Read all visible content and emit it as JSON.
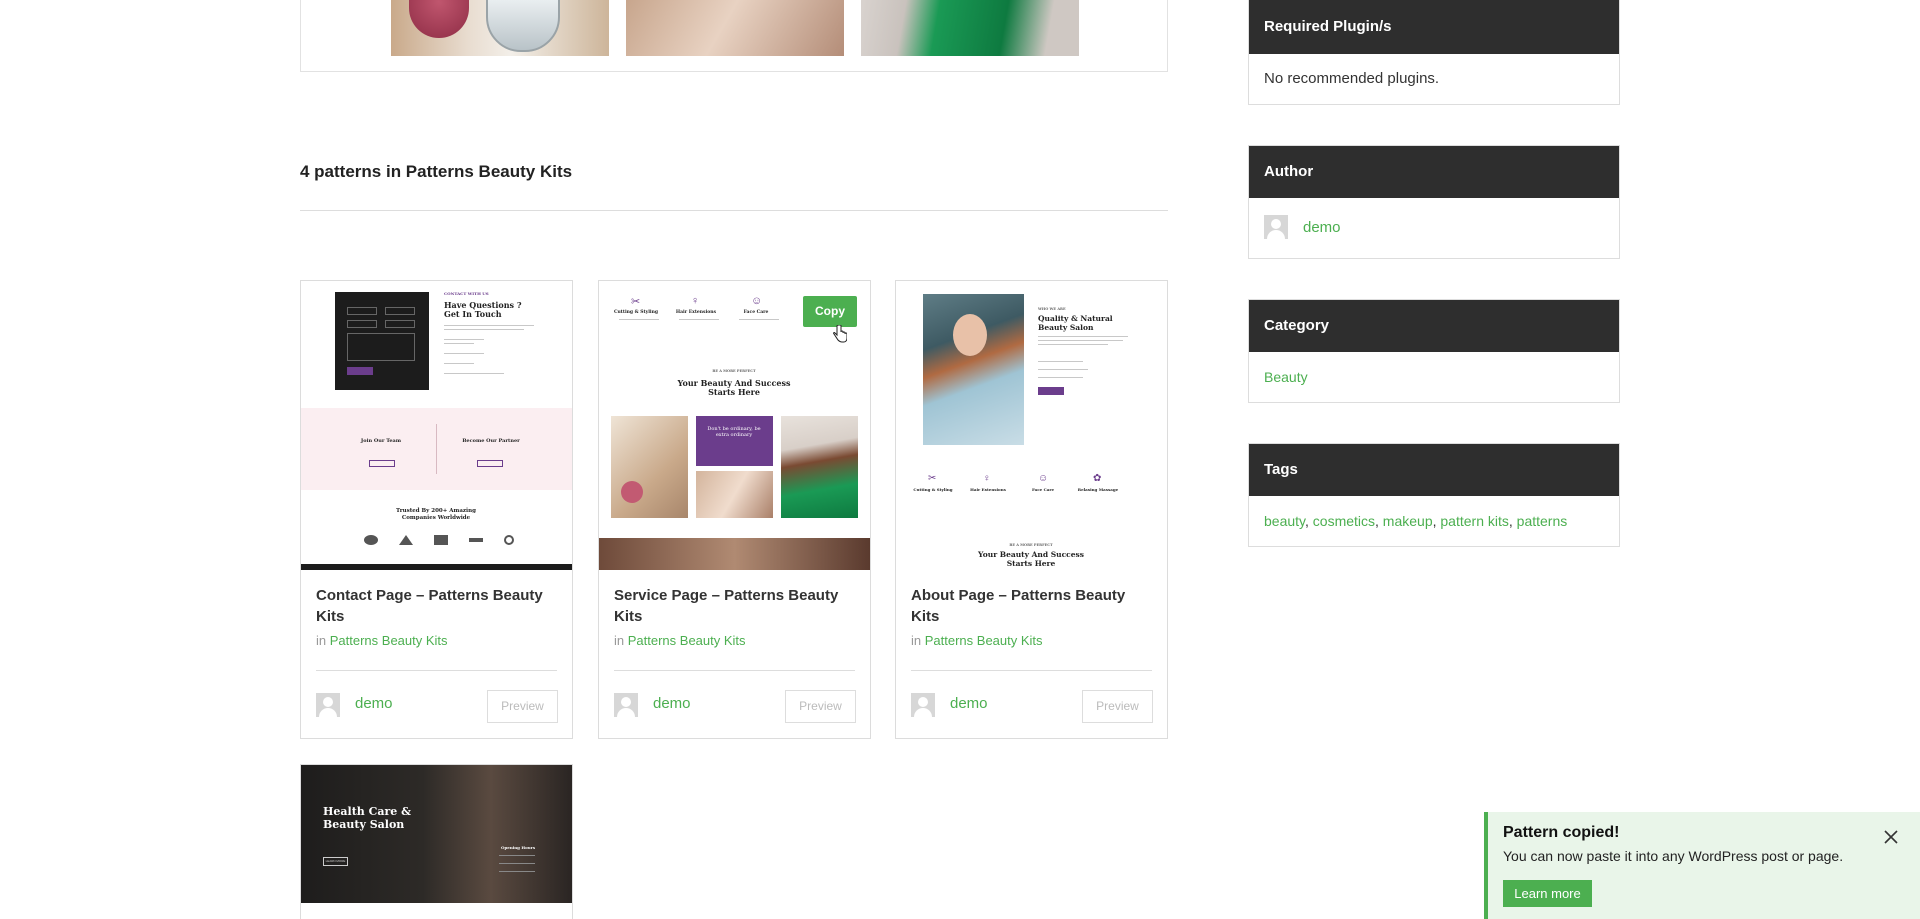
{
  "section": {
    "title": "4 patterns in Patterns Beauty Kits"
  },
  "cards": [
    {
      "title": "Contact Page – Patterns Beauty Kits",
      "category_prefix": "in",
      "category": "Patterns Beauty Kits",
      "author": "demo",
      "preview_label": "Preview",
      "mock": {
        "heading": "Have Questions ? Get In Touch",
        "eyebrow": "CONTACT WITH US",
        "box1": "Join Our Team",
        "box2": "Become Our Partner",
        "trusted": "Trusted By 200+ Amazing Companies Worldwide"
      }
    },
    {
      "title": "Service Page – Patterns Beauty Kits",
      "category_prefix": "in",
      "category": "Patterns Beauty Kits",
      "author": "demo",
      "preview_label": "Preview",
      "copy_label": "Copy",
      "mock": {
        "svc1": "Cutting & Styling",
        "svc2": "Hair Extensions",
        "svc3": "Face Care",
        "eyebrow": "BE A MORE PERFECT",
        "heading": "Your Beauty And Success Starts Here",
        "quote": "Don't be ordinary, be extra ordinary"
      }
    },
    {
      "title": "About Page – Patterns Beauty Kits",
      "category_prefix": "in",
      "category": "Patterns Beauty Kits",
      "author": "demo",
      "preview_label": "Preview",
      "mock": {
        "eyebrow": "WHO WE ARE",
        "heading": "Quality & Natural Beauty Salon",
        "svc1": "Cutting & Styling",
        "svc2": "Hair Extensions",
        "svc3": "Face Care",
        "svc4": "Relaxing Massage",
        "eyebrow2": "BE A MORE PERFECT",
        "heading2": "Your Beauty And Success Starts Here"
      }
    },
    {
      "mock": {
        "heading": "Health Care & Beauty Salon",
        "hours": "Opening Hours",
        "btn": "LEARN MORE"
      }
    }
  ],
  "sidebar": {
    "plugins": {
      "title": "Required Plugin/s",
      "text": "No recommended plugins."
    },
    "author": {
      "title": "Author",
      "name": "demo"
    },
    "category": {
      "title": "Category",
      "value": "Beauty"
    },
    "tags": {
      "title": "Tags",
      "items": [
        "beauty",
        "cosmetics",
        "makeup",
        "pattern kits",
        "patterns"
      ]
    }
  },
  "toast": {
    "title": "Pattern copied!",
    "message": "You can now paste it into any WordPress post or page.",
    "button": "Learn more"
  },
  "colors": {
    "accent": "#4caf50",
    "widget_head": "#2e2e2e",
    "mock_purple": "#6b3d8c",
    "toast_bg": "#e9f5e9"
  }
}
